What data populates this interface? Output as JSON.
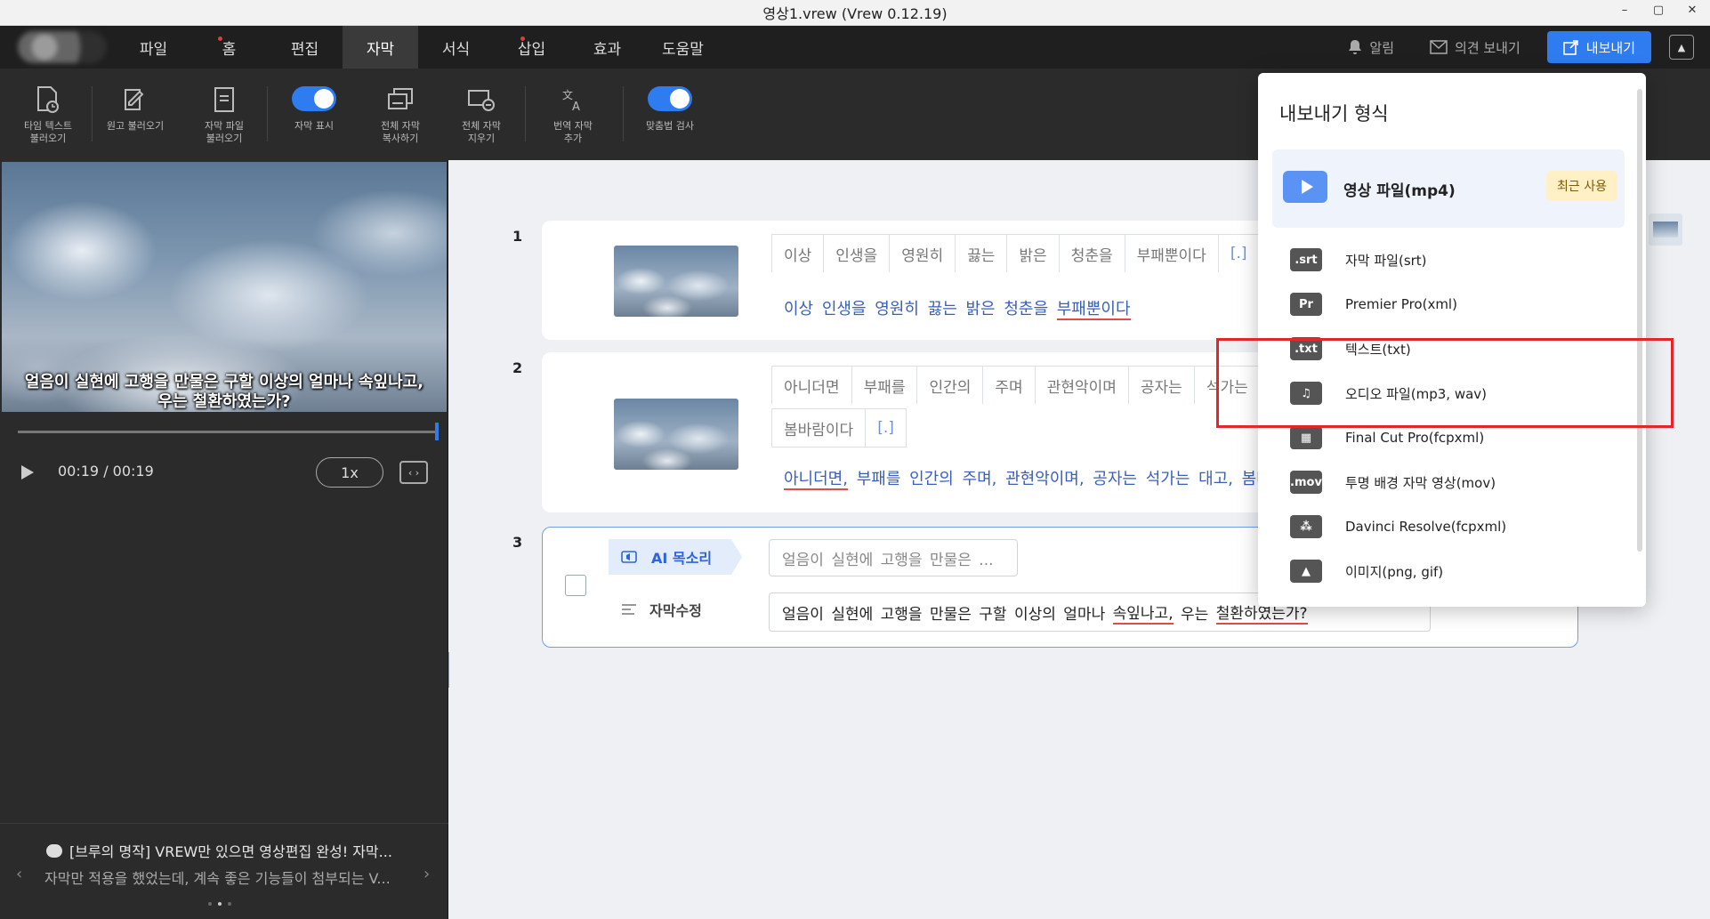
{
  "window": {
    "title": "영상1.vrew (Vrew 0.12.19)",
    "controls": [
      "–",
      "▢",
      "✕"
    ]
  },
  "menu": {
    "items": [
      {
        "label": "파일",
        "dot": false,
        "active": false
      },
      {
        "label": "홈",
        "dot": true,
        "active": false
      },
      {
        "label": "편집",
        "dot": false,
        "active": false
      },
      {
        "label": "자막",
        "dot": false,
        "active": true
      },
      {
        "label": "서식",
        "dot": false,
        "active": false
      },
      {
        "label": "삽입",
        "dot": true,
        "active": false
      },
      {
        "label": "효과",
        "dot": false,
        "active": false
      },
      {
        "label": "도움말",
        "dot": false,
        "active": false
      }
    ],
    "notifications": "알림",
    "feedback": "의견 보내기",
    "export": "내보내기"
  },
  "toolbar": {
    "tools": [
      {
        "name": "timed-text-import",
        "line1": "타임 텍스트",
        "line2": "불러오기",
        "icon": "doc-clock-icon"
      },
      {
        "name": "script-import",
        "line1": "원고 불러오기",
        "line2": "",
        "icon": "edit-doc-icon"
      },
      {
        "name": "subtitle-file-import",
        "line1": "자막 파일",
        "line2": "불러오기",
        "icon": "file-icon"
      },
      {
        "name": "show-subtitles",
        "line1": "자막 표시",
        "line2": "",
        "icon": "toggle",
        "on": true
      },
      {
        "name": "copy-all-subtitles",
        "line1": "전체 자막",
        "line2": "복사하기",
        "icon": "copy-icon"
      },
      {
        "name": "clear-all-subtitles",
        "line1": "전체 자막",
        "line2": "지우기",
        "icon": "clear-icon"
      },
      {
        "name": "add-translation",
        "line1": "번역 자막",
        "line2": "추가",
        "icon": "translate-icon"
      },
      {
        "name": "spell-check",
        "line1": "맞춤법 검사",
        "line2": "",
        "icon": "toggle",
        "on": true
      }
    ]
  },
  "player": {
    "subtitle_line1": "얼음이 실현에 고행을 만물은 구할 이상의 얼마나 속잎나고,",
    "subtitle_line2": "우는 철환하였는가?",
    "timecode": "00:19 / 00:19",
    "speed": "1x",
    "progress": 1.0
  },
  "notice": {
    "title": "[브루의 명작] VREW만 있으면 영상편집 완성! 자막...",
    "body": "자막만 적용을 했었는데, 계속 좋은 기능들이 첨부되는 V...",
    "prev": "‹",
    "next": "›"
  },
  "clips": [
    {
      "number": "1",
      "words": [
        "이상",
        "인생을",
        "영원히",
        "끓는",
        "밝은",
        "청춘을",
        "부패뿐이다",
        "[.]"
      ],
      "text_plain": "이상 인생을 영원히 끓는 밝은 청춘을",
      "text_underlined": "부패뿐이다"
    },
    {
      "number": "2",
      "words": [
        "아니더면",
        "부패를",
        "인간의",
        "주며",
        "관현악이며",
        "공자는",
        "석가는"
      ],
      "words_row2": [
        "봄바람이다",
        "[.]"
      ],
      "text_underlined": "아니더면,",
      "text_plain": "부패를 인간의 주며, 관현악이며, 공자는 석가는 대고, 봄바"
    },
    {
      "number": "3",
      "ai_voice_label": "AI 목소리",
      "ai_voice_preview": "얼음이 실현에 고행을 만물은 ...",
      "edit_label": "자막수정",
      "edit_text_a": "얼음이 실현에 고행을 만물은 구할 이상의 얼마나",
      "edit_text_b": "속잎나고,",
      "edit_text_c": "우는",
      "edit_text_d": "철환하였는가?"
    }
  ],
  "export_panel": {
    "title": "내보내기 형식",
    "featured": {
      "label": "영상 파일(mp4)",
      "badge": "최근 사용"
    },
    "items": [
      {
        "icon": ".srt",
        "label": "자막 파일(srt)",
        "name": "srt"
      },
      {
        "icon": "Pr",
        "label": "Premier Pro(xml)",
        "name": "premiere"
      },
      {
        "icon": ".txt",
        "label": "텍스트(txt)",
        "name": "txt"
      },
      {
        "icon": "♫",
        "label": "오디오 파일(mp3, wav)",
        "name": "audio"
      },
      {
        "icon": "▦",
        "label": "Final Cut Pro(fcpxml)",
        "name": "finalcut"
      },
      {
        "icon": ".mov",
        "label": "투명 배경 자막 영상(mov)",
        "name": "mov"
      },
      {
        "icon": "⁂",
        "label": "Davinci Resolve(fcpxml)",
        "name": "davinci"
      },
      {
        "icon": "▲",
        "label": "이미지(png, gif)",
        "name": "image"
      }
    ]
  },
  "colors": {
    "accent": "#2f7bf0",
    "highlight": "#e4262a",
    "menubar": "#1f1f1f",
    "toolbar": "#2b2b2b"
  }
}
